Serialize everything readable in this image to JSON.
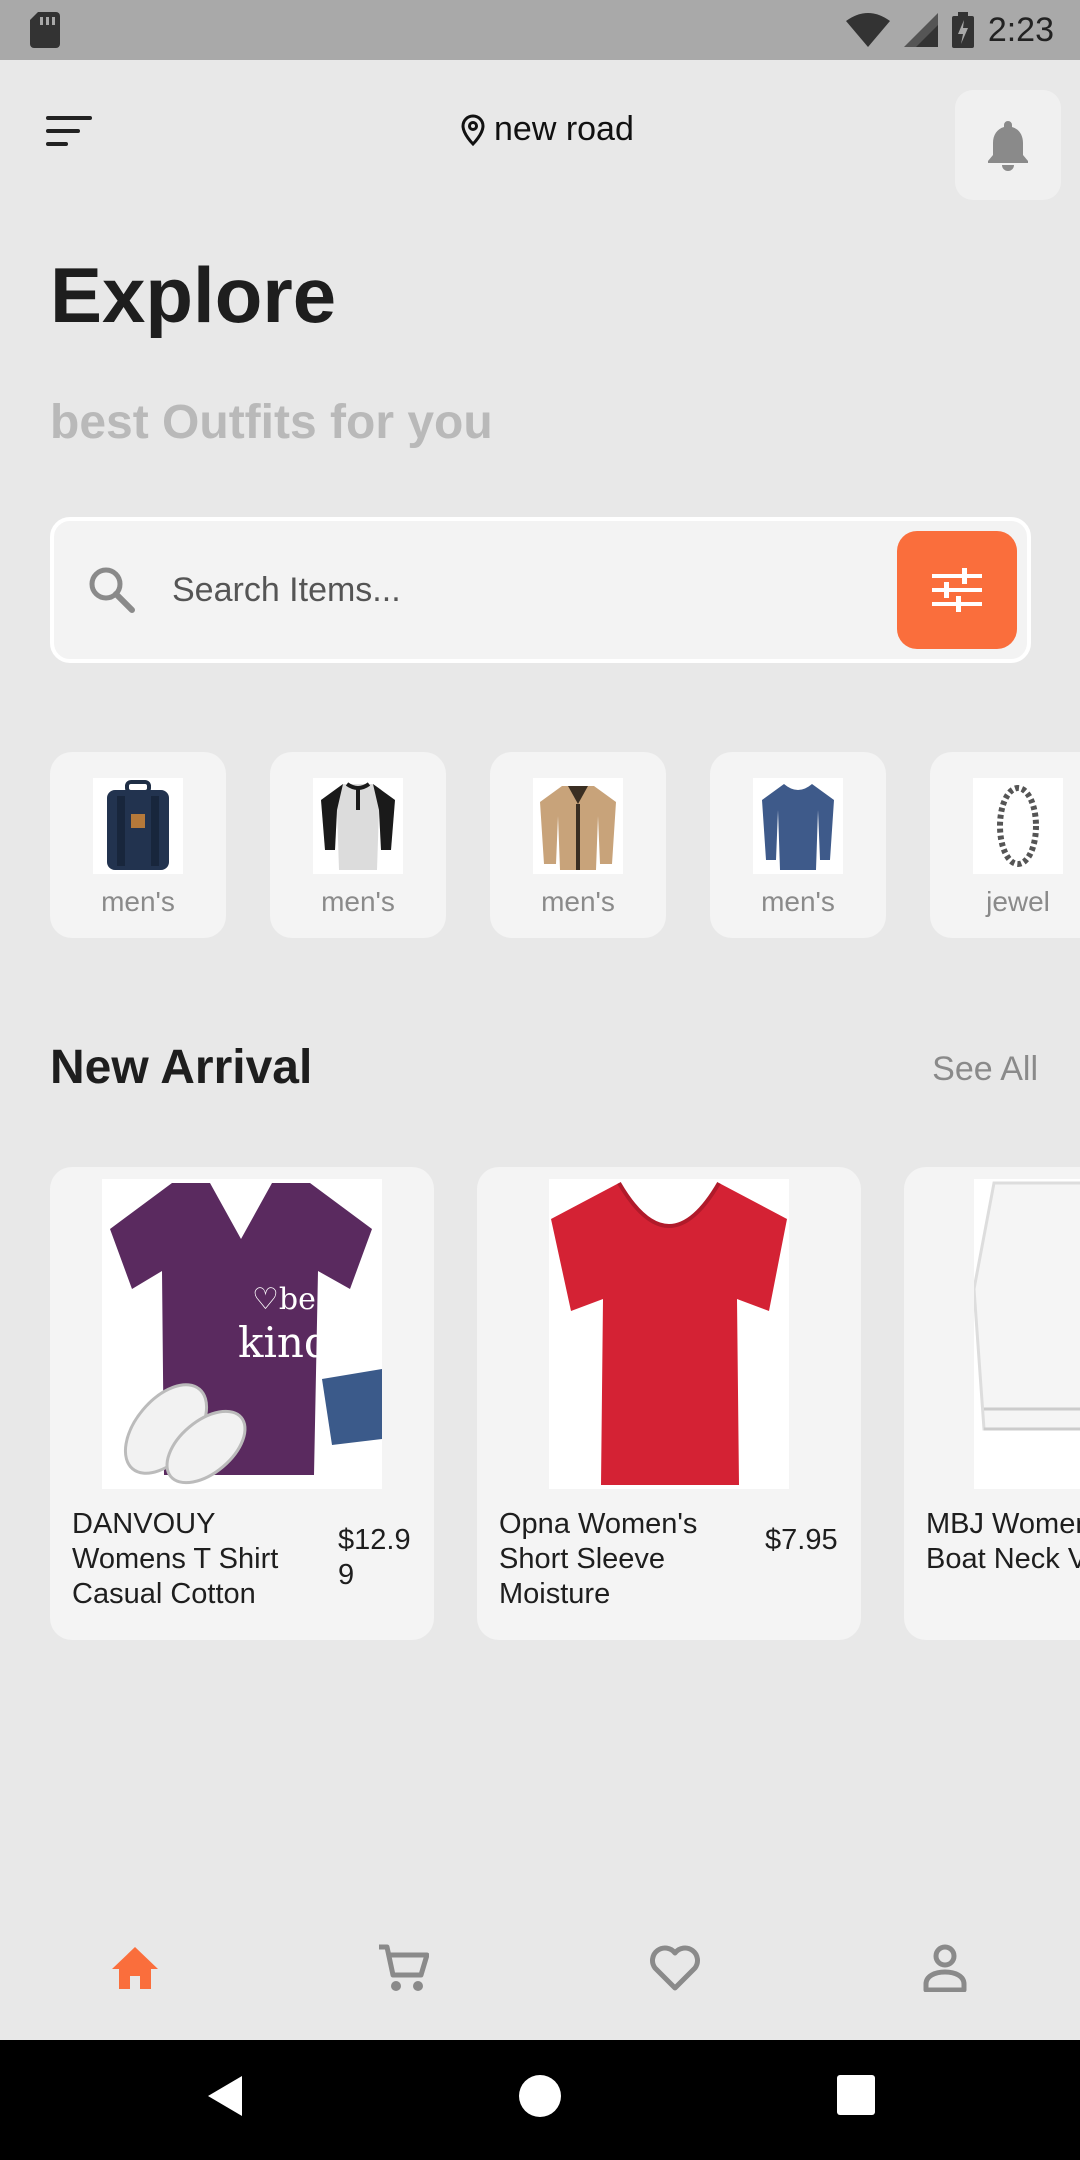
{
  "status_bar": {
    "time": "2:23"
  },
  "header": {
    "location": "new road"
  },
  "hero": {
    "title": "Explore",
    "subtitle": "best Outfits for you"
  },
  "search": {
    "placeholder": "Search Items..."
  },
  "categories": [
    {
      "label": "men's",
      "icon": "backpack-icon"
    },
    {
      "label": "men's",
      "icon": "henley-shirt-icon"
    },
    {
      "label": "men's",
      "icon": "jacket-icon"
    },
    {
      "label": "men's",
      "icon": "long-sleeve-shirt-icon"
    },
    {
      "label": "jewel",
      "icon": "bracelet-icon"
    }
  ],
  "new_arrival": {
    "title": "New Arrival",
    "see_all": "See All",
    "products": [
      {
        "name": "DANVOUY Womens T Shirt Casual Cotton",
        "price": "$12.99",
        "image": "purple-tshirt"
      },
      {
        "name": "Opna Women's Short Sleeve Moisture",
        "price": "$7.95",
        "image": "red-tshirt"
      },
      {
        "name": "MBJ Women's Solid Short Boat Neck V",
        "price": "",
        "image": "white-top"
      }
    ]
  },
  "colors": {
    "accent": "#fa6e3c",
    "background": "#e8e8e8",
    "card": "#f4f4f4"
  },
  "bottom_nav": [
    "home-icon",
    "cart-icon",
    "heart-icon",
    "profile-icon"
  ]
}
